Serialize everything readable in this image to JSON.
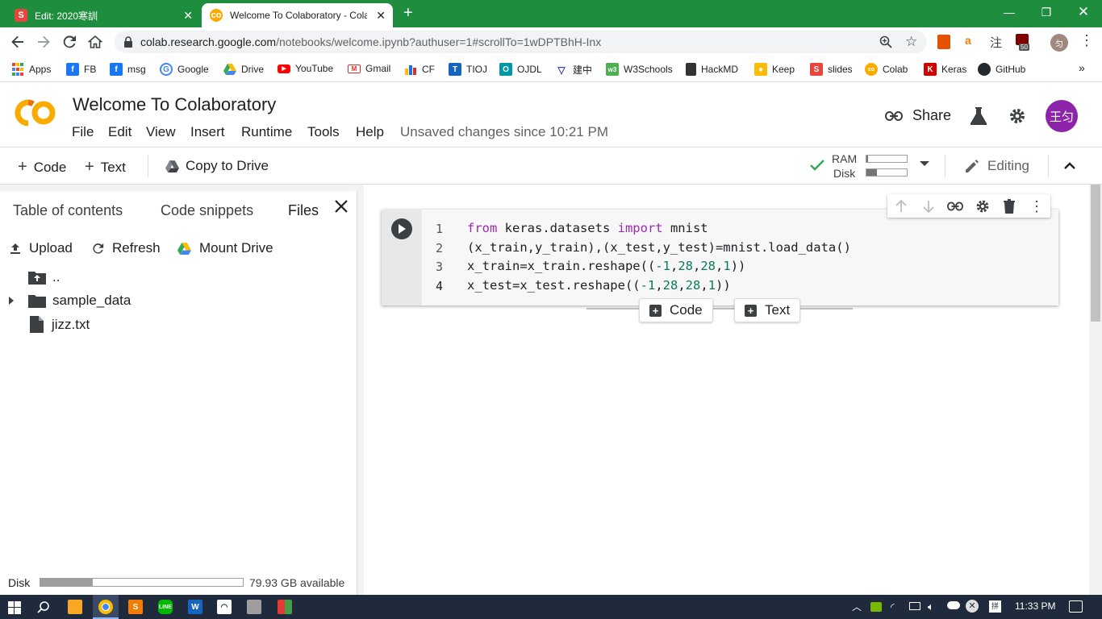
{
  "browser": {
    "tabs": [
      {
        "title": "Edit: 2020寒訓",
        "favicon": "slides-icon",
        "color": "#e8453c",
        "active": false
      },
      {
        "title": "Welcome To Colaboratory - Colab",
        "favicon": "colab-icon",
        "color": "#f9ab00",
        "active": true
      }
    ],
    "url_host": "colab.research.google.com",
    "url_path": "/notebooks/welcome.ipynb?authuser=1#scrollTo=1wDPTBhH-Inx",
    "ext_badge": "50",
    "profile_initial": "匀",
    "bookmarks": [
      {
        "label": "Apps",
        "icon": "apps-grid-icon",
        "color": "#4285f4"
      },
      {
        "label": "FB",
        "icon": "facebook-icon",
        "color": "#1877f2"
      },
      {
        "label": "msg",
        "icon": "facebook-icon",
        "color": "#1877f2"
      },
      {
        "label": "Google",
        "icon": "google-icon",
        "color": "#4285f4"
      },
      {
        "label": "Drive",
        "icon": "drive-icon",
        "color": "#fbbc04"
      },
      {
        "label": "YouTube",
        "icon": "youtube-icon",
        "color": "#ff0000"
      },
      {
        "label": "Gmail",
        "icon": "gmail-icon",
        "color": "#d93025"
      },
      {
        "label": "CF",
        "icon": "codeforces-icon",
        "color": "#1a73e8"
      },
      {
        "label": "TIOJ",
        "icon": "tioj-icon",
        "color": "#1565c0"
      },
      {
        "label": "OJDL",
        "icon": "ojdl-icon",
        "color": "#0097a7"
      },
      {
        "label": "建中",
        "icon": "school-icon",
        "color": "#3949ab"
      },
      {
        "label": "W3Schools",
        "icon": "w3schools-icon",
        "color": "#4caf50"
      },
      {
        "label": "HackMD",
        "icon": "hackmd-icon",
        "color": "#333333"
      },
      {
        "label": "Keep",
        "icon": "keep-icon",
        "color": "#fbbc04"
      },
      {
        "label": "slides",
        "icon": "slides-icon",
        "color": "#e8453c"
      },
      {
        "label": "Colab",
        "icon": "colab-icon",
        "color": "#f9ab00"
      },
      {
        "label": "Keras",
        "icon": "keras-icon",
        "color": "#d00000"
      },
      {
        "label": "GitHub",
        "icon": "github-icon",
        "color": "#24292e"
      }
    ]
  },
  "colab": {
    "title": "Welcome To Colaboratory",
    "menu": [
      "File",
      "Edit",
      "View",
      "Insert",
      "Runtime",
      "Tools",
      "Help"
    ],
    "unsaved": "Unsaved changes since 10:21 PM",
    "share_label": "Share",
    "avatar_text": "王匀",
    "avatar_color": "#8e24aa",
    "toolbar": {
      "add_code": "Code",
      "add_text": "Text",
      "copy_to_drive": "Copy to Drive",
      "ram_label": "RAM",
      "disk_label": "Disk",
      "ram_usage": 0.04,
      "disk_usage": 0.25,
      "editing": "Editing"
    },
    "sidepanel": {
      "tabs": [
        "Table of contents",
        "Code snippets",
        "Files"
      ],
      "active_tab": "Files",
      "actions": {
        "upload": "Upload",
        "refresh": "Refresh",
        "mount": "Mount Drive"
      },
      "files": [
        {
          "name": "..",
          "icon": "folder-up-icon"
        },
        {
          "name": "sample_data",
          "icon": "folder-icon"
        },
        {
          "name": "jizz.txt",
          "icon": "file-icon"
        }
      ],
      "disk_label": "Disk",
      "disk_usage": 0.26,
      "disk_available": "79.93 GB available"
    },
    "cell": {
      "line_numbers": [
        "1",
        "2",
        "3",
        "4"
      ],
      "lines": [
        "from keras.datasets import mnist",
        "(x_train,y_train),(x_test,y_test)=mnist.load_data()",
        "x_train=x_train.reshape((-1,28,28,1))",
        "x_test=x_test.reshape((-1,28,28,1))"
      ]
    },
    "insert": {
      "code": "Code",
      "text": "Text"
    }
  },
  "taskbar": {
    "clock": "11:33 PM"
  }
}
